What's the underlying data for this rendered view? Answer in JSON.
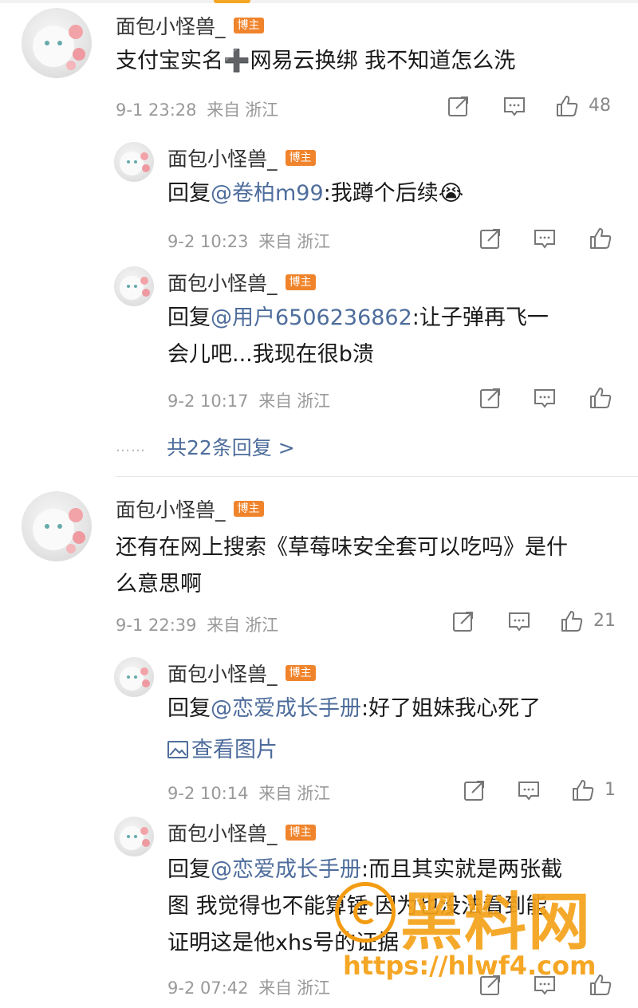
{
  "comments": [
    {
      "user": "面包小怪兽_",
      "badge": "博主",
      "text": "支付宝实名➕网易云换绑 我不知道怎么洗",
      "date": "9-1 23:28",
      "from": "来自",
      "location": "浙江",
      "likes": "48",
      "replies": [
        {
          "user": "面包小怪兽_",
          "badge": "博主",
          "reply_prefix": "回复",
          "mention": "@卷柏m99",
          "text": ":我蹲个后续😭",
          "date": "9-2 10:23",
          "from": "来自",
          "location": "浙江",
          "likes": ""
        },
        {
          "user": "面包小怪兽_",
          "badge": "博主",
          "reply_prefix": "回复",
          "mention": "@用户6506236862",
          "text_line1": ":让子弹再飞一",
          "text_line2": "会儿吧...我现在很b溃",
          "date": "9-2 10:17",
          "from": "来自",
          "location": "浙江",
          "likes": ""
        }
      ],
      "more_replies": "共22条回复 >"
    },
    {
      "user": "面包小怪兽_",
      "badge": "博主",
      "text_line1": "还有在网上搜索《草莓味安全套可以吃吗》是什",
      "text_line2": "么意思啊",
      "date": "9-1 22:39",
      "from": "来自",
      "location": "浙江",
      "likes": "21",
      "replies": [
        {
          "user": "面包小怪兽_",
          "badge": "博主",
          "reply_prefix": "回复",
          "mention": "@恋爱成长手册",
          "text": ":好了姐妹我心死了",
          "picture_link": "查看图片",
          "date": "9-2 10:14",
          "from": "来自",
          "location": "浙江",
          "likes": "1"
        },
        {
          "user": "面包小怪兽_",
          "badge": "博主",
          "reply_prefix": "回复",
          "mention": "@恋爱成长手册",
          "text_line1": ":而且其实就是两张截",
          "text_line2": "图 我觉得也不能算锤 因为也没法看到能",
          "text_line3": "证明这是他xhs号的证据",
          "date": "9-2 07:42",
          "from": "来自",
          "location": "浙江",
          "likes": ""
        }
      ]
    }
  ],
  "watermark": {
    "title": "黑料网",
    "url": "https://hlwf4.com"
  },
  "colors": {
    "badge": "#f0842c",
    "mention": "#4e6d9c",
    "meta": "#999999",
    "watermark": "#f5a21a"
  },
  "icons": {
    "share": "share-icon",
    "comment": "comment-icon",
    "like": "thumbs-up-icon",
    "picture": "image-icon"
  }
}
